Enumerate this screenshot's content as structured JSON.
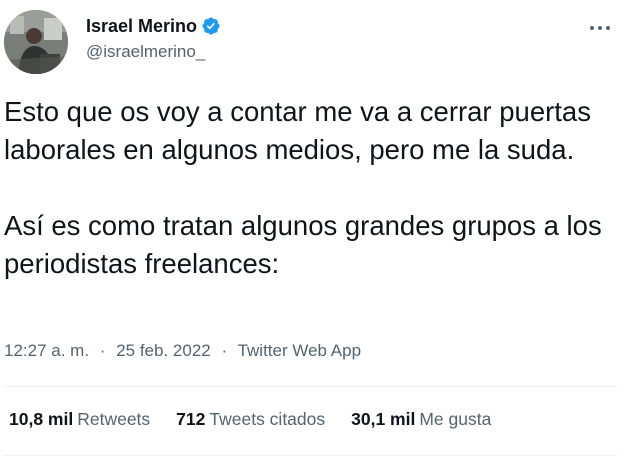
{
  "author": {
    "display_name": "Israel Merino",
    "handle": "@israelmerino_",
    "verified": true,
    "avatar_icon": "profile-photo",
    "verified_icon": "verified-badge-icon"
  },
  "menu": {
    "more_icon": "more-options-icon"
  },
  "tweet": {
    "paragraphs": [
      "Esto que os voy a contar me va a cerrar puertas laborales en algunos medios, pero me la suda.",
      "Así es como tratan algunos grandes grupos a los periodistas freelances:"
    ],
    "time": "12:27 a. m.",
    "separator": "·",
    "date": "25 feb. 2022",
    "source": "Twitter Web App"
  },
  "stats": {
    "retweets_count": "10,8 mil",
    "retweets_label": "Retweets",
    "quotes_count": "712",
    "quotes_label": "Tweets citados",
    "likes_count": "30,1 mil",
    "likes_label": "Me gusta"
  },
  "colors": {
    "text_primary": "#0f1419",
    "text_secondary": "#536471",
    "verified_blue": "#1d9bf0",
    "divider": "#eff3f4"
  }
}
